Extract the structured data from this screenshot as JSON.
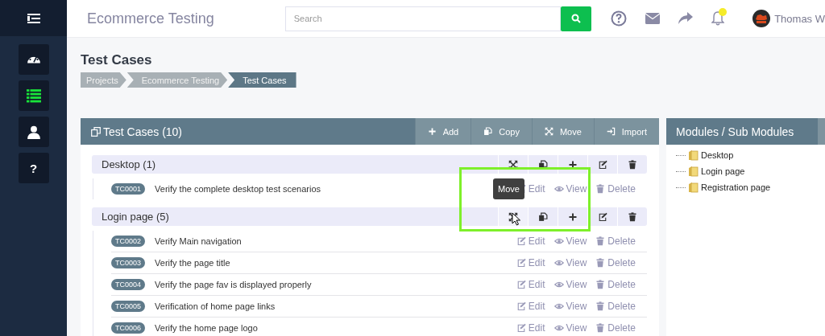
{
  "sidebar": {
    "items": [
      {
        "kind": "dashboard",
        "selected": false
      },
      {
        "kind": "list",
        "selected": true
      },
      {
        "kind": "user",
        "selected": false
      },
      {
        "kind": "help",
        "label": "?",
        "selected": false
      }
    ]
  },
  "header": {
    "title": "Ecommerce Testing",
    "search": {
      "placeholder": "Search"
    },
    "notifications_unread": true,
    "user": {
      "name": "Thomas W"
    }
  },
  "page": {
    "title": "Test Cases",
    "breadcrumbs": [
      {
        "label": "Projects",
        "selected": false
      },
      {
        "label": "Ecommerce Testing",
        "selected": false
      },
      {
        "label": "Test Cases",
        "selected": true
      }
    ]
  },
  "test_cases_panel": {
    "title": "Test Cases (10)",
    "toolbar": [
      {
        "kind": "add",
        "label": "Add"
      },
      {
        "kind": "copy",
        "label": "Copy"
      },
      {
        "kind": "move",
        "label": "Move"
      },
      {
        "kind": "import",
        "label": "Import"
      }
    ],
    "groups": [
      {
        "name": "Desktop",
        "count": "(1)",
        "actions": [
          {
            "kind": "move",
            "hovered": false
          },
          {
            "kind": "copy",
            "hovered": false
          },
          {
            "kind": "add",
            "hovered": false
          },
          {
            "kind": "edit",
            "hovered": false
          },
          {
            "kind": "delete",
            "hovered": false
          }
        ],
        "cases": [
          {
            "id": "TC0001",
            "title": "Verify the complete desktop test scenarios",
            "actions": [
              "Edit",
              "View",
              "Delete"
            ]
          }
        ]
      },
      {
        "name": "Login page",
        "count": "(5)",
        "actions": [
          {
            "kind": "move",
            "hovered": true,
            "tooltip": "Move"
          },
          {
            "kind": "copy",
            "hovered": false
          },
          {
            "kind": "add",
            "hovered": false
          },
          {
            "kind": "edit",
            "hovered": false
          },
          {
            "kind": "delete",
            "hovered": false
          }
        ],
        "cases": [
          {
            "id": "TC0002",
            "title": "Verify Main navigation",
            "actions": [
              "Edit",
              "View",
              "Delete"
            ]
          },
          {
            "id": "TC0003",
            "title": "Verify the page title",
            "actions": [
              "Edit",
              "View",
              "Delete"
            ]
          },
          {
            "id": "TC0004",
            "title": "Verify the page fav is displayed properly",
            "actions": [
              "Edit",
              "View",
              "Delete"
            ]
          },
          {
            "id": "TC0005",
            "title": "Verification of home page links",
            "actions": [
              "Edit",
              "View",
              "Delete"
            ]
          },
          {
            "id": "TC0006",
            "title": "Verify the home page logo",
            "actions": [
              "Edit",
              "View",
              "Delete"
            ]
          }
        ]
      }
    ]
  },
  "modules_panel": {
    "title": "Modules / Sub Modules",
    "tree": [
      {
        "label": "Desktop"
      },
      {
        "label": "Login page"
      },
      {
        "label": "Registration page"
      }
    ]
  }
}
